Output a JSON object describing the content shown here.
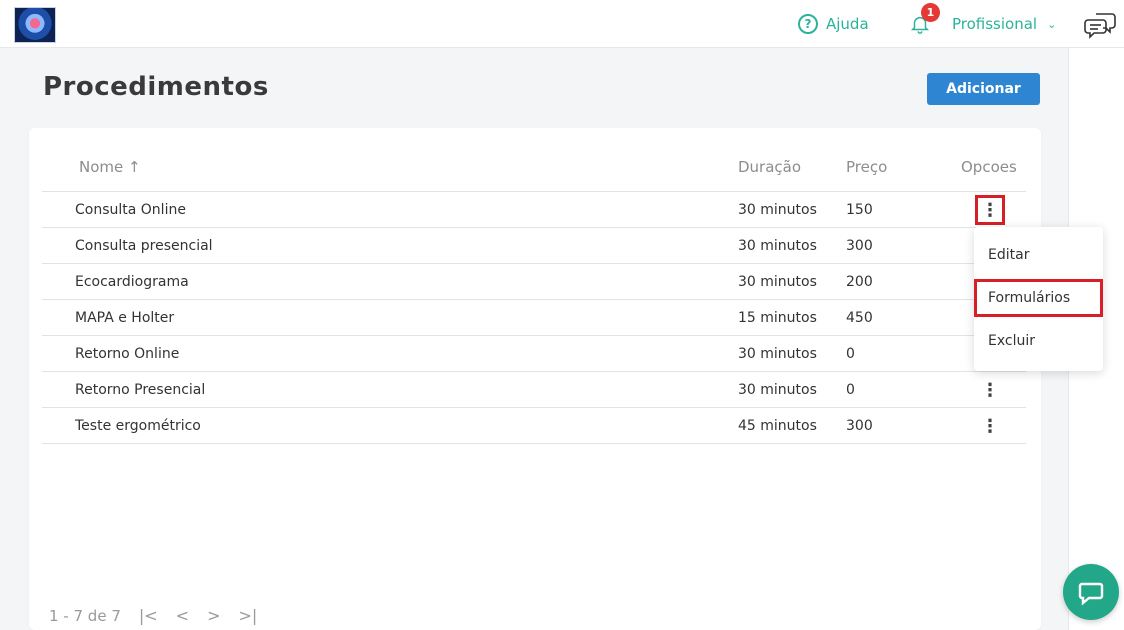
{
  "topbar": {
    "help_label": "Ajuda",
    "notification_count": "1",
    "profile_label": "Profissional"
  },
  "page": {
    "title": "Procedimentos",
    "add_label": "Adicionar"
  },
  "table": {
    "headers": {
      "nome": "Nome ↑",
      "duracao": "Duração",
      "preco": "Preço",
      "opcoes": "Opcoes"
    },
    "rows": [
      {
        "nome": "Consulta Online",
        "duracao": "30 minutos",
        "preco": "150"
      },
      {
        "nome": "Consulta presencial",
        "duracao": "30 minutos",
        "preco": "300"
      },
      {
        "nome": "Ecocardiograma",
        "duracao": "30 minutos",
        "preco": "200"
      },
      {
        "nome": "MAPA e Holter",
        "duracao": "15 minutos",
        "preco": "450"
      },
      {
        "nome": "Retorno Online",
        "duracao": "30 minutos",
        "preco": "0"
      },
      {
        "nome": "Retorno Presencial",
        "duracao": "30 minutos",
        "preco": "0"
      },
      {
        "nome": "Teste ergométrico",
        "duracao": "45 minutos",
        "preco": "300"
      }
    ]
  },
  "pagination": {
    "range_label": "1 - 7 de 7"
  },
  "menu": {
    "items": [
      "Editar",
      "Formulários",
      "Excluir"
    ]
  },
  "colors": {
    "accent": "#2bb39a",
    "primary_button": "#2e86d3",
    "highlight": "#d61f26",
    "badge": "#e53935",
    "chat_fab": "#22a889"
  }
}
